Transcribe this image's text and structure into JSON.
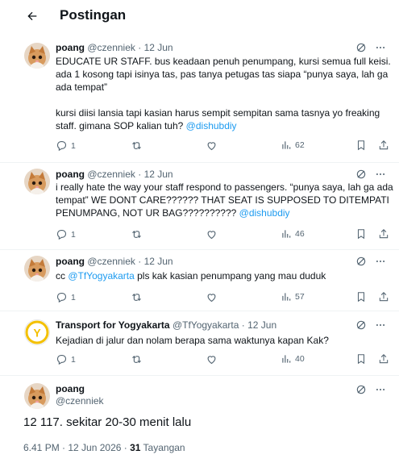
{
  "header": {
    "title": "Postingan",
    "back_icon": "arrow-left-icon"
  },
  "colors": {
    "accent": "#1d9bf0",
    "text": "#0f1419",
    "muted": "#536471",
    "border": "#eff3f4",
    "transport_yellow": "#f3c000"
  },
  "tweets": [
    {
      "name": "poang",
      "handle": "@czenniek",
      "dot": "·",
      "date": "12 Jun",
      "paragraphs": [
        "EDUCATE UR STAFF. bus keadaan penuh penumpang, kursi semua full keisi. ada 1 kosong tapi isinya tas, pas tanya petugas tas siapa “punya saya, lah ga ada tempat”",
        "kursi diisi lansia tapi kasian harus sempit sempitan sama tasnya yo freaking staff. gimana SOP kalian tuh?"
      ],
      "mention": "@dishubdiy",
      "replies": "1",
      "views": "62"
    },
    {
      "name": "poang",
      "handle": "@czenniek",
      "dot": "·",
      "date": "12 Jun",
      "text": "i really hate the way your staff respond to passengers. “punya saya, lah ga ada tempat” WE DONT CARE?????? THAT SEAT IS SUPPOSED TO DITEMPATI PENUMPANG, NOT UR BAG?????????? ",
      "mention": "@dishubdiy",
      "replies": "1",
      "views": "46"
    },
    {
      "name": "poang",
      "handle": "@czenniek",
      "dot": "·",
      "date": "12 Jun",
      "prefix": "cc ",
      "mention": "@TfYogyakarta",
      "text": " pls kak kasian penumpang  yang mau duduk",
      "replies": "1",
      "views": "57"
    },
    {
      "name": "Transport for Yogyakarta",
      "handle": "@TfYogyakarta",
      "dot": "·",
      "date": "12 Jun",
      "text": "Kejadian di jalur dan nolam berapa sama waktunya kapan Kak?",
      "replies": "1",
      "views": "40",
      "avatar_letter": "Y"
    }
  ],
  "main": {
    "name": "poang",
    "handle": "@czenniek",
    "text": "12 117. sekitar 20-30 menit lalu",
    "time": "6.41 PM · 12 Jun 2026 · ",
    "views_count": "31",
    "views_label": " Tayangan"
  }
}
